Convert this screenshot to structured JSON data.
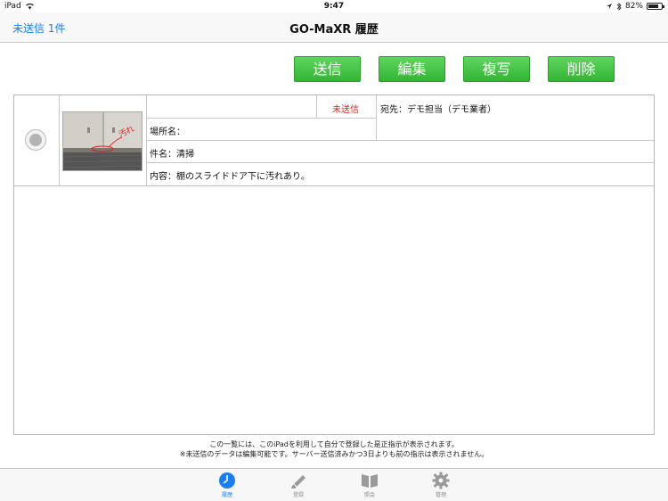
{
  "status_bar": {
    "device": "iPad",
    "time": "9:47",
    "battery": "82%",
    "battery_level": 0.82
  },
  "navbar": {
    "back_label": "未送信 1件",
    "title": "GO-MaXR 履歴"
  },
  "toolbar": {
    "send_label": "送信",
    "edit_label": "編集",
    "copy_label": "複写",
    "delete_label": "削除"
  },
  "records": [
    {
      "status": "未送信",
      "recipient": "宛先：デモ担当（デモ業者）",
      "location": "場所名：",
      "subject": "件名：清掃",
      "content": "内容：棚のスライドドア下に汚れあり。",
      "photo_annotation": "汚れ"
    }
  ],
  "footer": {
    "line1": "この一覧には、このiPadを利用して自分で登録した是正指示が表示されます。",
    "line2": "※未送信のデータは編集可能です。サーバー送信済みかつ3日よりも前の指示は表示されません。"
  },
  "tabs": [
    {
      "label": "履歴",
      "icon": "clock-icon",
      "active": true
    },
    {
      "label": "登録",
      "icon": "pencil-icon",
      "active": false
    },
    {
      "label": "照会",
      "icon": "book-icon",
      "active": false
    },
    {
      "label": "管理",
      "icon": "gear-icon",
      "active": false
    }
  ],
  "colors": {
    "accent": "#1a7ef0",
    "button_green": "#3dbb3d",
    "unsent_red": "#e0201a"
  }
}
